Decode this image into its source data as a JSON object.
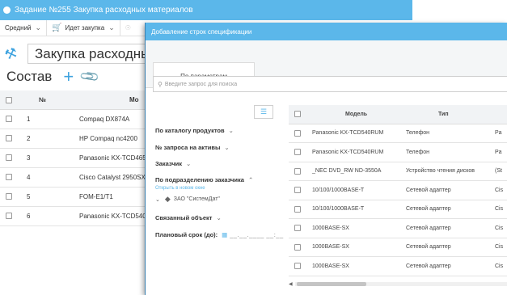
{
  "window": {
    "title": "Задание №255 Закупка расходных материалов"
  },
  "toolbar": {
    "priority": "Средний",
    "status": "Идет закупка"
  },
  "task": {
    "name": "Закупка расходных м"
  },
  "section": {
    "title": "Состав"
  },
  "bg_table": {
    "headers": {
      "num": "№",
      "model": "Мо"
    },
    "rows": [
      {
        "num": "1",
        "model": "Compaq DX874A"
      },
      {
        "num": "2",
        "model": "HP Compaq nc4200"
      },
      {
        "num": "3",
        "model": "Panasonic KX-TCD465"
      },
      {
        "num": "4",
        "model": "Cisco Catalyst 2950SX"
      },
      {
        "num": "5",
        "model": "FOM-E1/T1"
      },
      {
        "num": "6",
        "model": "Panasonic KX-TCD540"
      }
    ]
  },
  "modal": {
    "title": "Добавление строк спецификации",
    "tab": "По параметрам",
    "search_placeholder": "Введите запрос для поиска",
    "filters": {
      "catalog": "По каталогу продуктов",
      "asset_request": "№ запроса на активы",
      "customer": "Заказчик",
      "department": "По подразделению заказчика",
      "open_link": "Открыть в новом окне",
      "org": "ЗАО \"СистемДат\"",
      "linked_object": "Связанный объект",
      "planned_date_label": "Плановый срок (до):",
      "planned_date_mask": "__.__.____ __:__"
    },
    "table": {
      "headers": {
        "model": "Модель",
        "type": "Тип"
      },
      "rows": [
        {
          "model": "Panasonic KX-TCD540RUM",
          "type": "Телефон",
          "extra": "Pa"
        },
        {
          "model": "Panasonic KX-TCD540RUM",
          "type": "Телефон",
          "extra": "Pa"
        },
        {
          "model": "_NEC DVD_RW ND-3550A",
          "type": "Устройство чтения дисков",
          "extra": "(St"
        },
        {
          "model": "10/100/1000BASE-T",
          "type": "Сетевой адаптер",
          "extra": "Cis"
        },
        {
          "model": "10/100/1000BASE-T",
          "type": "Сетевой адаптер",
          "extra": "Cis"
        },
        {
          "model": "1000BASE-SX",
          "type": "Сетевой адаптер",
          "extra": "Cis"
        },
        {
          "model": "1000BASE-SX",
          "type": "Сетевой адаптер",
          "extra": "Cis"
        },
        {
          "model": "1000BASE-SX",
          "type": "Сетевой адаптер",
          "extra": "Cis"
        }
      ]
    }
  },
  "icons": {
    "cart": "cart-icon",
    "wrench": "wrench-icon",
    "plus": "plus-icon",
    "paperclip": "paperclip-icon",
    "search": "search-icon",
    "filter": "filter-icon",
    "calendar": "calendar-icon",
    "tag": "tag-icon"
  },
  "colors": {
    "accent": "#5bb7ea",
    "header_bg": "#f1f3f5",
    "link": "#5bb7ea"
  }
}
